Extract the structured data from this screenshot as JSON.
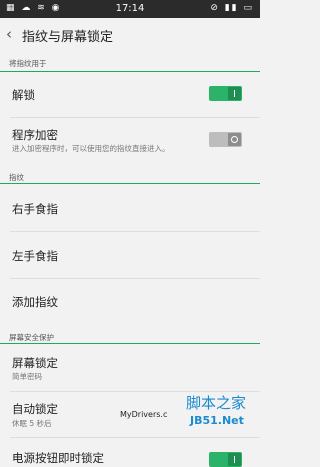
{
  "status_bar": {
    "time": "17:14",
    "left_icons": [
      "grid-icon",
      "cloud-icon",
      "wifi-icon",
      "bell-icon"
    ],
    "right_icons": [
      "mute-icon",
      "signal-icon",
      "battery-icon"
    ]
  },
  "header": {
    "title": "指纹与屏幕锁定"
  },
  "sections": {
    "fingerprint_use": {
      "label": "将指纹用于"
    },
    "fingerprint": {
      "label": "指纹"
    },
    "screen_security": {
      "label": "屏幕安全保护"
    }
  },
  "rows": {
    "unlock": {
      "title": "解锁",
      "toggle_on": true
    },
    "app_encrypt": {
      "title": "程序加密",
      "subtitle": "进入加密程序时，可以使用您的指纹直接进入。",
      "toggle_on": false
    },
    "right_index": {
      "title": "右手食指"
    },
    "left_index": {
      "title": "左手食指"
    },
    "add_fp": {
      "title": "添加指纹"
    },
    "screen_lock": {
      "title": "屏幕锁定",
      "subtitle": "简单密码"
    },
    "auto_lock": {
      "title": "自动锁定",
      "subtitle": "休眠 5 秒后"
    },
    "power_lock": {
      "title": "电源按钮即时锁定"
    }
  },
  "watermark": {
    "site": "MyDrivers.c",
    "brand": "脚本之家",
    "brand_sub": "JB51.Net"
  },
  "colors": {
    "accent_green": "#23a85a",
    "status_bar": "#2b2b2b",
    "background": "#f2f2f2"
  }
}
